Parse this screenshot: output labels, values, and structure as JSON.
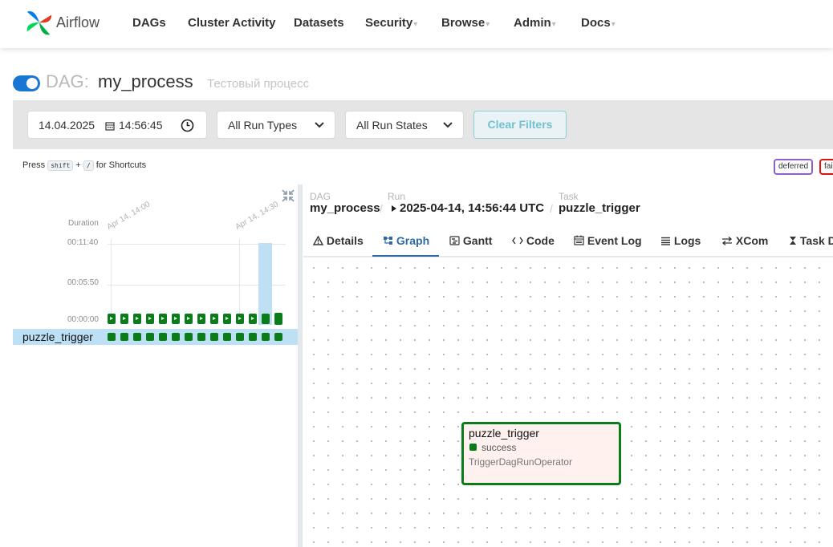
{
  "nav": {
    "brand": "Airflow",
    "items": [
      "DAGs",
      "Cluster Activity",
      "Datasets",
      "Security",
      "Browse",
      "Admin",
      "Docs"
    ],
    "dropdown_caret": "▾"
  },
  "dag": {
    "prefix": "DAG:",
    "name": "my_process",
    "description": "Тестовый процесс",
    "paused": false
  },
  "filters": {
    "date": "14.04.2025",
    "time": "14:56:45",
    "run_types": "All Run Types",
    "run_states": "All Run States",
    "clear_label": "Clear Filters"
  },
  "shortcuts": {
    "press": "Press",
    "key1": "shift",
    "plus": "+",
    "key2": "/",
    "suffix": "for Shortcuts"
  },
  "legend": {
    "deferred": "deferred",
    "failed": "failed"
  },
  "grid": {
    "duration_label": "Duration",
    "y_ticks": [
      "00:11:40",
      "00:05:50",
      "00:00:00"
    ],
    "date_labels": [
      "Apr 14, 14:00",
      "Apr 14, 14:30"
    ],
    "run_count": 14,
    "selected_run_index": 12,
    "selected_run_duration_fraction": 0.87,
    "task_name": "puzzle_trigger",
    "task_states": [
      "success",
      "success",
      "success",
      "success",
      "success",
      "success",
      "success",
      "success",
      "success",
      "success",
      "success",
      "success",
      "success",
      "success"
    ]
  },
  "breadcrumb": {
    "dag_label": "DAG",
    "dag_value": "my_process",
    "run_label": "Run",
    "run_value": "2025-04-14, 14:56:44 UTC",
    "task_label": "Task",
    "task_value": "puzzle_trigger",
    "separator": "/"
  },
  "tabs": [
    {
      "label": "Details",
      "icon": "warning-triangle-icon"
    },
    {
      "label": "Graph",
      "icon": "graph-icon",
      "active": true
    },
    {
      "label": "Gantt",
      "icon": "gantt-icon"
    },
    {
      "label": "Code",
      "icon": "code-icon"
    },
    {
      "label": "Event Log",
      "icon": "calendar-icon"
    },
    {
      "label": "Logs",
      "icon": "list-icon"
    },
    {
      "label": "XCom",
      "icon": "swap-arrows-icon"
    },
    {
      "label": "Task Duration",
      "icon": "hourglass-icon"
    }
  ],
  "graph_node": {
    "task_id": "puzzle_trigger",
    "state": "success",
    "operator": "TriggerDagRunOperator"
  },
  "colors": {
    "success": "#0a7d1a",
    "accent": "#2d6aa3",
    "toggle": "#1976d2"
  }
}
